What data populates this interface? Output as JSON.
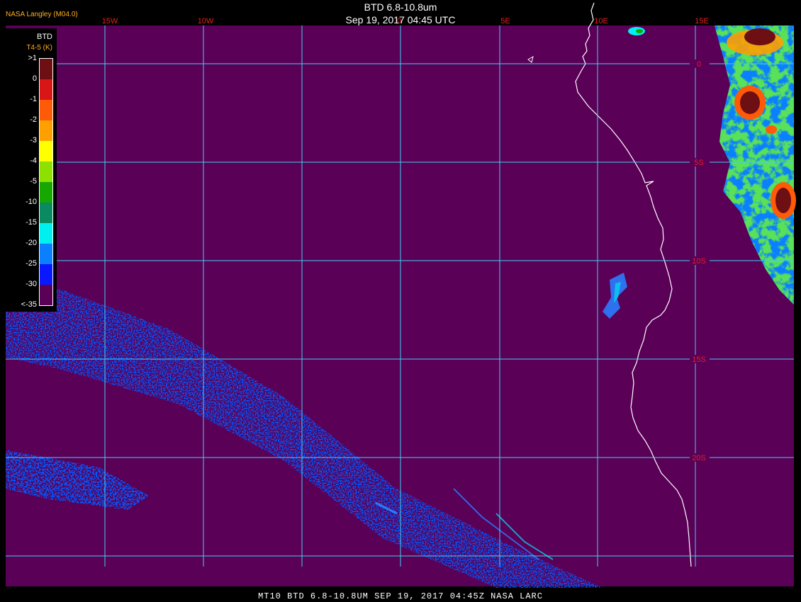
{
  "header": {
    "source": "NASA Langley (M04.0)",
    "title": "BTD 6.8-10.8um",
    "subtitle": "Sep 19, 2017 04:45 UTC"
  },
  "footer": {
    "text": "MT10  BTD 6.8-10.8UM  SEP 19, 2017 04:45Z  NASA LARC"
  },
  "legend": {
    "title": "BTD",
    "subtitle": "T4-5 (K)",
    "ticks": [
      ">1",
      "0",
      "-1",
      "-2",
      "-3",
      "-4",
      "-5",
      "-10",
      "-15",
      "-20",
      "-25",
      "-30",
      "<-35"
    ],
    "colors": [
      "#6e0f14",
      "#d81616",
      "#ff5a08",
      "#ffa000",
      "#ffff00",
      "#8ee000",
      "#16a800",
      "#0a8a60",
      "#00f0f0",
      "#0a80ff",
      "#0a18ff",
      "#5a0057"
    ]
  },
  "map": {
    "background_color": "#5a0057",
    "grid_color": "#40d0f0",
    "label_color": "#e02020",
    "coast_color": "#ffffff",
    "lon_labels": [
      "15W",
      "10W",
      "0",
      "5E",
      "10E",
      "15E"
    ],
    "lat_labels": [
      "0",
      "5S",
      "10S",
      "15S",
      "20S"
    ]
  }
}
